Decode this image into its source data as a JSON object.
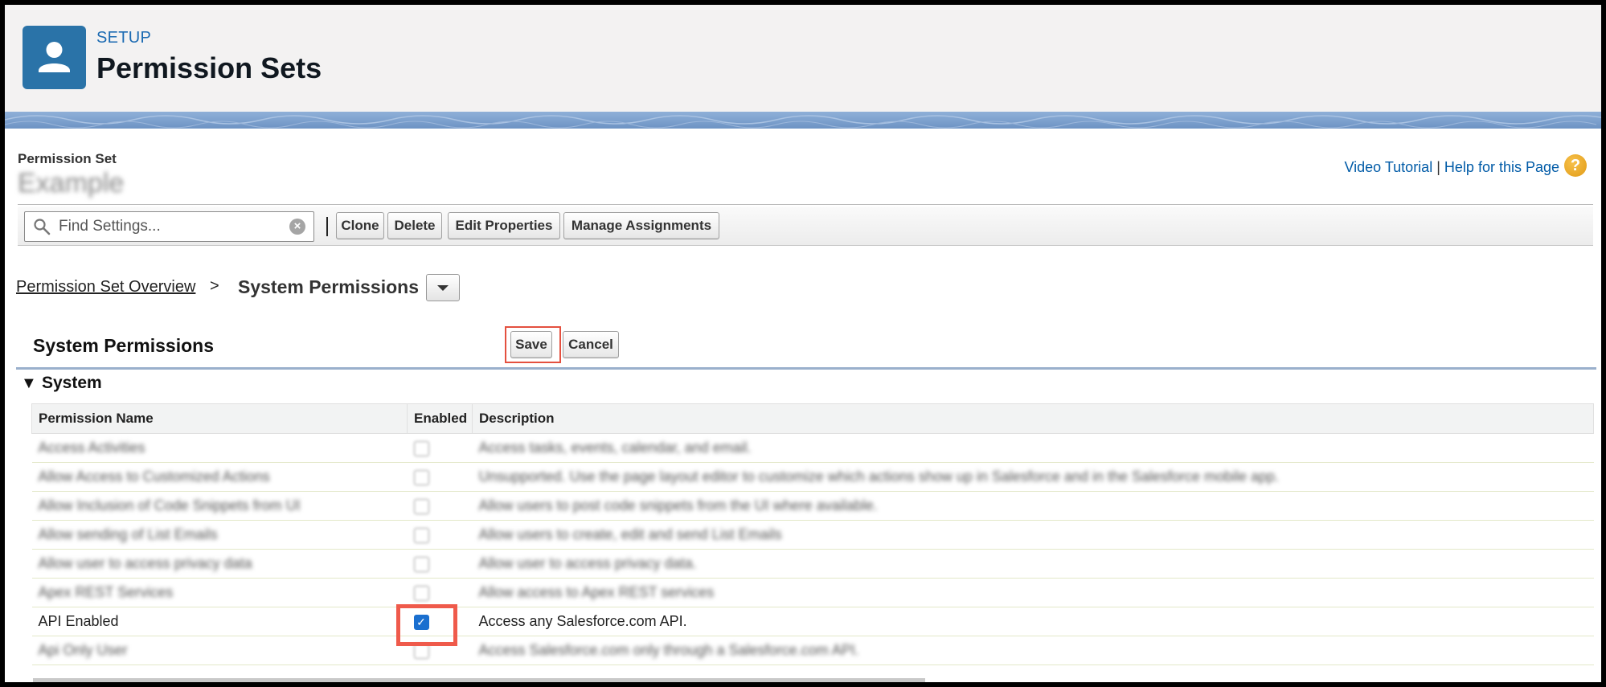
{
  "header": {
    "setup_label": "SETUP",
    "title": "Permission Sets"
  },
  "permission_set": {
    "label": "Permission Set",
    "name": "Example"
  },
  "help": {
    "video_tutorial": "Video Tutorial",
    "separator": "|",
    "help_page": "Help for this Page"
  },
  "toolbar": {
    "search_placeholder": "Find Settings...",
    "clone": "Clone",
    "delete": "Delete",
    "edit_properties": "Edit Properties",
    "manage_assignments": "Manage Assignments"
  },
  "breadcrumb": {
    "overview": "Permission Set Overview",
    "separator": ">",
    "current": "System Permissions"
  },
  "section": {
    "title": "System Permissions",
    "save": "Save",
    "cancel": "Cancel",
    "group": "System"
  },
  "table": {
    "columns": [
      "Permission Name",
      "Enabled",
      "Description"
    ],
    "rows": [
      {
        "name": "Access Activities",
        "enabled": false,
        "description": "Access tasks, events, calendar, and email."
      },
      {
        "name": "Allow Access to Customized Actions",
        "enabled": false,
        "description": "Unsupported. Use the page layout editor to customize which actions show up in Salesforce and in the Salesforce mobile app."
      },
      {
        "name": "Allow Inclusion of Code Snippets from UI",
        "enabled": false,
        "description": "Allow users to post code snippets from the UI where available."
      },
      {
        "name": "Allow sending of List Emails",
        "enabled": false,
        "description": "Allow users to create, edit and send List Emails"
      },
      {
        "name": "Allow user to access privacy data",
        "enabled": false,
        "description": "Allow user to access privacy data."
      },
      {
        "name": "Apex REST Services",
        "enabled": false,
        "description": "Allow access to Apex REST services"
      },
      {
        "name": "API Enabled",
        "enabled": true,
        "description": "Access any Salesforce.com API."
      },
      {
        "name": "Api Only User",
        "enabled": false,
        "description": "Access Salesforce.com only through a Salesforce.com API."
      }
    ]
  },
  "colors": {
    "link": "#015ba7",
    "header_icon": "#2a73a8",
    "highlight": "#ef5a4b"
  }
}
